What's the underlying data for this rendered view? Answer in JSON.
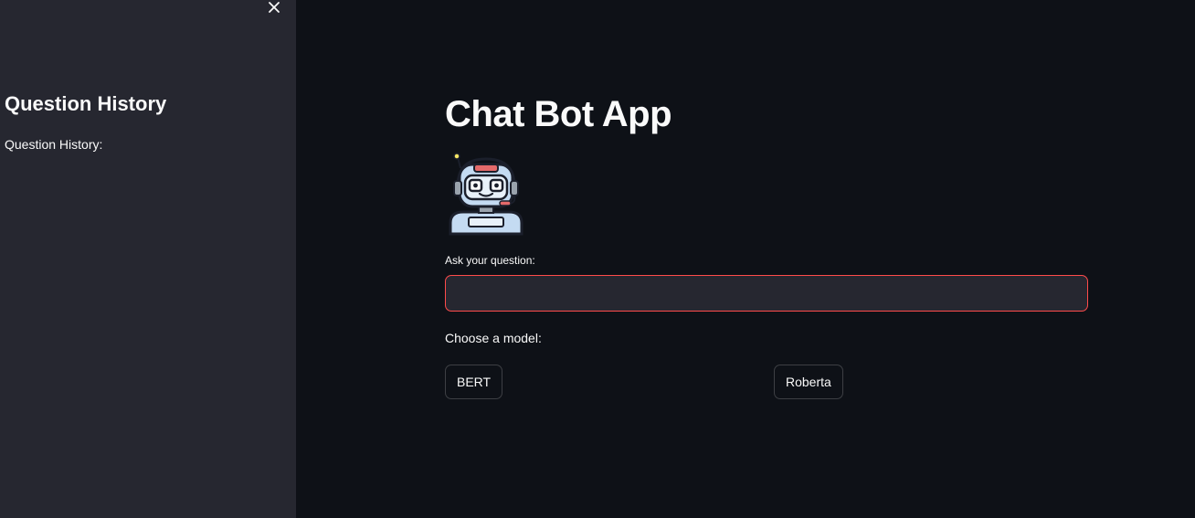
{
  "sidebar": {
    "close_icon": "close-icon",
    "title": "Question History",
    "subtitle": "Question History:"
  },
  "main": {
    "title": "Chat Bot App",
    "avatar_icon": "robot-headset-icon",
    "question": {
      "label": "Ask your question:",
      "value": "",
      "placeholder": ""
    },
    "model_label": "Choose a model:",
    "models": [
      {
        "label": "BERT"
      },
      {
        "label": "Roberta"
      }
    ]
  },
  "colors": {
    "background": "#0e1117",
    "sidebar": "#262730",
    "input_border_focus": "#ff4b4b",
    "text": "#fafafa"
  }
}
